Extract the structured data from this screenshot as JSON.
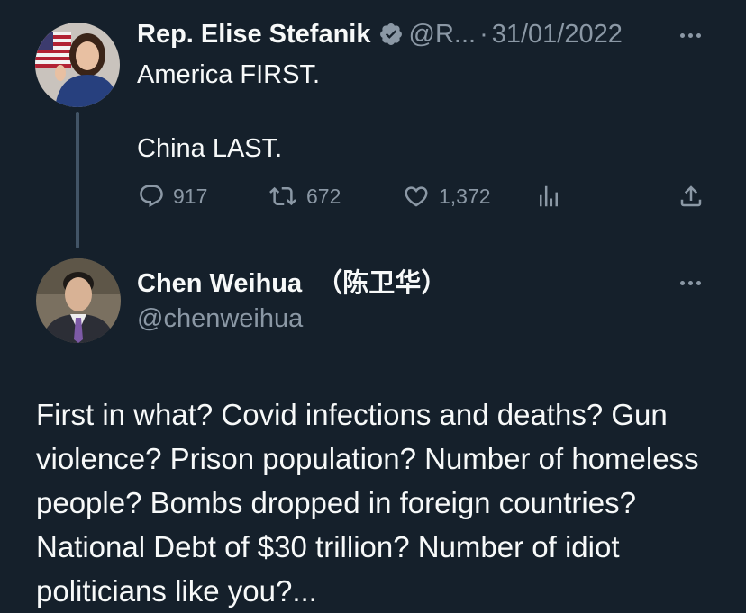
{
  "colors": {
    "background": "#15202b",
    "text_primary": "#f7f9f9",
    "text_secondary": "#8b98a5",
    "verified_badge": "#8b98a5",
    "thread_line": "#425466"
  },
  "tweet": {
    "author_name": "Rep. Elise Stefanik",
    "verified_icon": "verified-badge-icon",
    "handle": "@R...",
    "separator": "·",
    "date": "31/01/2022",
    "text_line1": "America FIRST.",
    "text_line2": "China LAST.",
    "stats": {
      "replies": "917",
      "retweets": "672",
      "likes": "1,372"
    },
    "icons": {
      "reply": "reply-bubble-icon",
      "retweet": "retweet-icon",
      "like": "heart-icon",
      "views": "analytics-bars-icon",
      "share": "share-upload-icon",
      "more": "more-dots-icon"
    }
  },
  "reply": {
    "author_name": "Chen Weihua  （陈卫华）",
    "handle": "@chenweihua",
    "body": "First in what? Covid infections and deaths? Gun violence? Prison population? Number of homeless people? Bombs dropped in foreign countries? National Debt of $30 trillion? Number of idiot politicians like you?..."
  }
}
